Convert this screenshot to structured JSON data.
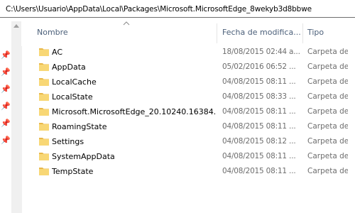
{
  "address_bar": {
    "path": "C:\\Users\\Usuario\\AppData\\Local\\Packages\\Microsoft.MicrosoftEdge_8wekyb3d8bbwe"
  },
  "columns": {
    "name": "Nombre",
    "date": "Fecha de modifica...",
    "type": "Tipo"
  },
  "files": [
    {
      "name": "AC",
      "date": "18/08/2015 02:44 a...",
      "type": "Carpeta de a"
    },
    {
      "name": "AppData",
      "date": "05/02/2016 06:52 ...",
      "type": "Carpeta de a"
    },
    {
      "name": "LocalCache",
      "date": "04/08/2015 08:11 ...",
      "type": "Carpeta de a"
    },
    {
      "name": "LocalState",
      "date": "04/08/2015 08:33 ...",
      "type": "Carpeta de a"
    },
    {
      "name": "Microsoft.MicrosoftEdge_20.10240.16384....",
      "date": "04/08/2015 08:11 ...",
      "type": "Carpeta de a"
    },
    {
      "name": "RoamingState",
      "date": "04/08/2015 08:11 ...",
      "type": "Carpeta de a"
    },
    {
      "name": "Settings",
      "date": "04/08/2015 08:12 ...",
      "type": "Carpeta de a"
    },
    {
      "name": "SystemAppData",
      "date": "04/08/2015 08:11 ...",
      "type": "Carpeta de a"
    },
    {
      "name": "TempState",
      "date": "04/08/2015 08:11 ...",
      "type": "Carpeta de a"
    }
  ],
  "icons": {
    "folder": "folder-icon",
    "pin": "pin-icon",
    "sort": "sort-ascending-icon"
  },
  "colors": {
    "folder_body": "#f8d775",
    "folder_tab": "#e8b84a",
    "header_text": "#4c607a",
    "secondary_text": "#6d6d6d"
  }
}
